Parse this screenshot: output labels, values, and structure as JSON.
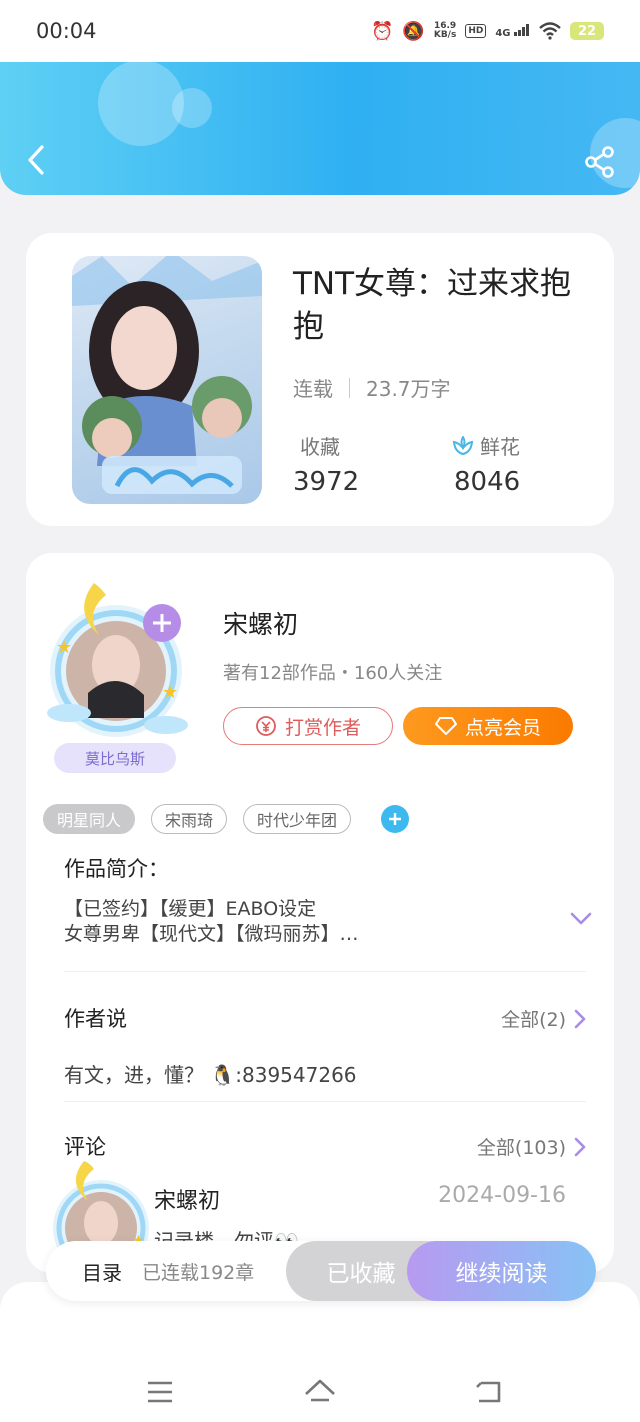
{
  "status_bar": {
    "time": "00:04",
    "net_speed_value": "16.9",
    "net_speed_unit": "KB/s",
    "hd_label": "HD",
    "network_label": "4G",
    "battery_level": "22"
  },
  "book": {
    "title": "TNT女尊：过来求抱抱",
    "status": "连载",
    "word_count": "23.7万字",
    "favorites_label": "收藏",
    "favorites_count": "3972",
    "flowers_label": "鲜花",
    "flowers_count": "8046"
  },
  "author": {
    "name": "宋螺初",
    "meta": "著有12部作品・160人关注",
    "badge": "莫比乌斯",
    "tip_label": "打赏作者",
    "vip_label": "点亮会员"
  },
  "tags": [
    "明星同人",
    "宋雨琦",
    "时代少年团"
  ],
  "intro": {
    "title": "作品简介：",
    "line1": "【已签约】【缓更】EABO设定",
    "line2": "女尊男卑【现代文】【微玛丽苏】…"
  },
  "author_says": {
    "title": "作者说",
    "all_label": "全部(2)",
    "text": "有文，进，懂？ 🐧:839547266"
  },
  "comments": {
    "title": "评论",
    "all_label": "全部(103)",
    "first": {
      "name": "宋螺初",
      "date": "2024-09-16",
      "text": "记录楼，勿评👀"
    }
  },
  "action_bar": {
    "toc_label": "目录",
    "chapters_label": "已连载192章",
    "collected_label": "已收藏",
    "continue_label": "继续阅读"
  },
  "colors": {
    "header_blue": "#2fb0f2",
    "accent_orange": "#fb7a00",
    "tip_red": "#e05b5b",
    "tag_add_blue": "#3db9ef",
    "chevron_purple": "#a98be8"
  }
}
